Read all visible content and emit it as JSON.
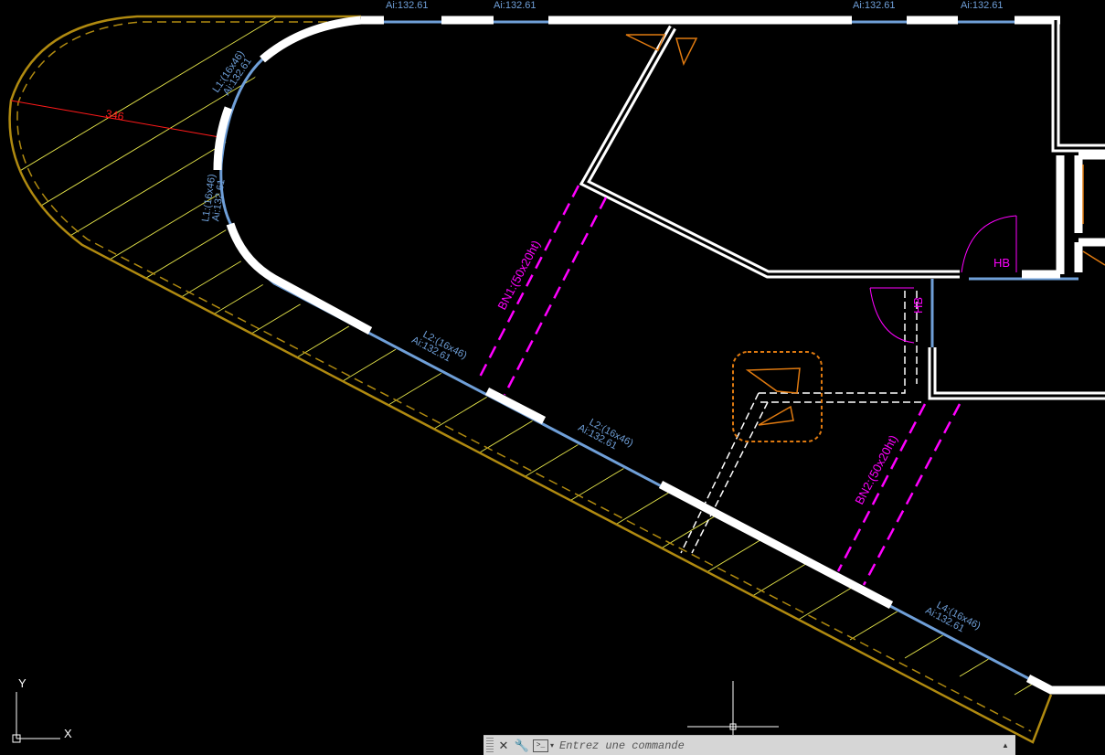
{
  "colors": {
    "background": "#000000",
    "wall": "#ffffff",
    "beam_blue": "#6f9fd8",
    "beam_pink": "#ff00ff",
    "hatch_outline": "#b08a10",
    "hatch_lines": "#e6e64a",
    "dimension_red": "#ff1a1a",
    "cloud_orange": "#e07a10"
  },
  "top_labels": [
    "Ai:132.61",
    "Ai:132.61",
    "Ai:132.61",
    "Ai:132.61"
  ],
  "beam_labels": {
    "l1": {
      "name": "L1:(16x46)",
      "area": "Ai:132.61"
    },
    "l1b": {
      "name": "L1:(16x46)",
      "area": "Ai:132.61"
    },
    "l2": {
      "name": "L2:(16x46)",
      "area": "Ai:132.61"
    },
    "l2b": {
      "name": "L2:(16x46)",
      "area": "Ai:132.61"
    },
    "l4": {
      "name": "L4:(16x46)",
      "area": "Ai:132.61"
    }
  },
  "bn_labels": {
    "bn1": "BN1:(50x20ht)",
    "bn2": "BN2:(50x20ht)"
  },
  "dimension": "346",
  "hb_labels": [
    "HB",
    "HB"
  ],
  "ucs": {
    "y_axis": "Y",
    "x_axis": "X"
  },
  "command_line": {
    "placeholder": "Entrez une commande",
    "close_icon": "close-icon",
    "customize_icon": "wrench-icon",
    "prompt_icon": "command-prompt-icon"
  }
}
